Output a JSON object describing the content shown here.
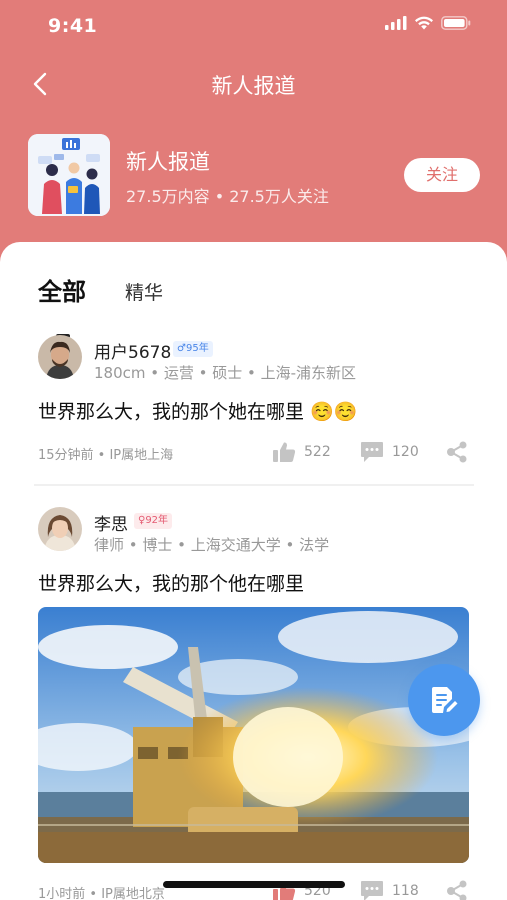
{
  "status_bar": {
    "time": "9:41"
  },
  "nav": {
    "title": "新人报道"
  },
  "topic": {
    "name": "新人报道",
    "stats": "27.5万内容 • 27.5万人关注",
    "follow_label": "关注"
  },
  "tabs": [
    {
      "label": "全部",
      "active": true
    },
    {
      "label": "精华",
      "active": false
    }
  ],
  "posts": [
    {
      "author": "用户5678",
      "age_badge": "♂95年",
      "meta": "180cm • 运营 • 硕士 • 上海-浦东新区",
      "text": "世界那么大，我的那个她在哪里 ☺️☺️",
      "time": "15分钟前 • IP属地上海",
      "likes": "522",
      "comments": "120"
    },
    {
      "author": "李思",
      "age_badge": "♀92年",
      "meta": "律师 • 博士 • 上海交通大学 • 法学",
      "text": "世界那么大，我的那个他在哪里",
      "time": "1小时前 • IP属地北京",
      "likes": "520",
      "comments": "118"
    }
  ],
  "colors": {
    "header": "#e27c79",
    "follow_text": "#e06f6c",
    "fab": "#4c97ee"
  },
  "icons": [
    "back-icon",
    "signal-icon",
    "wifi-icon",
    "battery-icon",
    "like-icon",
    "comment-icon",
    "share-icon",
    "edit-note-icon"
  ]
}
